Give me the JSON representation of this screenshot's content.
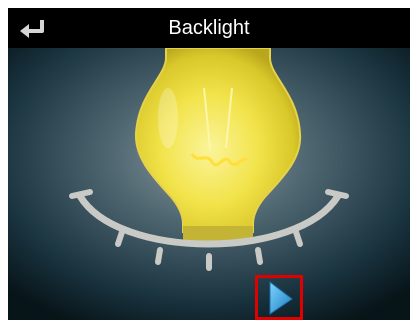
{
  "header": {
    "title": "Backlight",
    "back_icon": "return-arrow-icon"
  },
  "main": {
    "illustration_icon": "light-bulb-icon",
    "level_control_icon": "dial-arc-icon",
    "next_icon": "play-triangle-icon"
  },
  "colors": {
    "titlebar_bg": "#000000",
    "screen_bg": "#0a1a22",
    "bulb_yellow": "#f2e34a",
    "filament": "#ffdf3a",
    "dial": "#c9c9c6",
    "next_button": "#2aa3e4",
    "highlight_box": "#e00000"
  }
}
